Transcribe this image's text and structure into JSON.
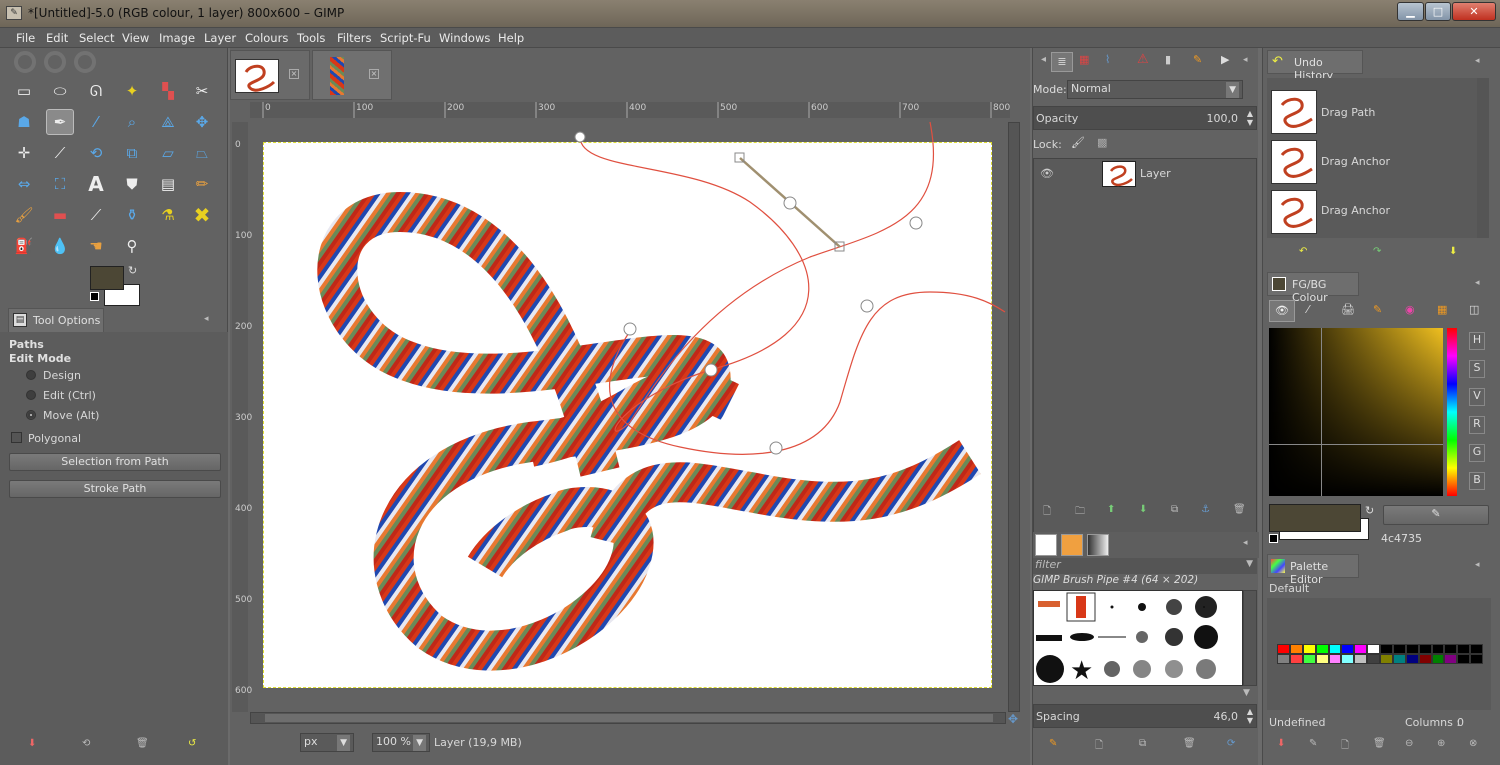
{
  "window": {
    "title": "*[Untitled]-5.0 (RGB colour, 1 layer) 800x600 – GIMP",
    "app_icon": "gimp-icon",
    "controls": [
      "minimize-icon",
      "maximize-icon",
      "close-icon"
    ]
  },
  "menu": [
    "File",
    "Edit",
    "Select",
    "View",
    "Image",
    "Layer",
    "Colours",
    "Tools",
    "Filters",
    "Script-Fu",
    "Windows",
    "Help"
  ],
  "tool_options": {
    "tab_label": "Tool Options",
    "tool_name": "Paths",
    "section": "Edit Mode",
    "modes": [
      "Design",
      "Edit (Ctrl)",
      "Move (Alt)"
    ],
    "selected_mode": "Move (Alt)",
    "polygonal_label": "Polygonal",
    "polygonal_checked": false,
    "btn_selection": "Selection from Path",
    "btn_stroke": "Stroke Path"
  },
  "colors": {
    "fg": "#4c4735",
    "bg": "#ffffff",
    "accent_path": "#e05040",
    "rope_colors": [
      "#d83818",
      "#2048b0",
      "#e87830",
      "#6a8a58",
      "#e8e8f0",
      "#c02818"
    ]
  },
  "rulers": {
    "h_ticks": [
      "0",
      "100",
      "200",
      "300",
      "400",
      "500",
      "600",
      "700",
      "800"
    ],
    "v_ticks": [
      "0",
      "100",
      "200",
      "300",
      "400",
      "500",
      "600"
    ]
  },
  "statusbar": {
    "unit": "px",
    "zoom": "100 %",
    "info": "Layer (19,9 MB)"
  },
  "layers": {
    "mode_label": "Mode:",
    "mode_value": "Normal",
    "opacity_label": "Opacity",
    "opacity_value": "100,0",
    "lock_label": "Lock:",
    "items": [
      {
        "name": "Layer",
        "visible": true
      }
    ]
  },
  "brushes": {
    "filter_placeholder": "filter",
    "current": "GIMP Brush Pipe #4 (64 × 202)",
    "spacing_label": "Spacing",
    "spacing_value": "46,0"
  },
  "undo": {
    "title": "Undo History",
    "items": [
      "Drag Path",
      "Drag Anchor",
      "Drag Anchor"
    ]
  },
  "fgbg": {
    "title": "FG/BG Colour",
    "hex": "4c4735",
    "channels": [
      "H",
      "S",
      "V",
      "R",
      "G",
      "B"
    ]
  },
  "palette": {
    "title": "Palette Editor",
    "name": "Default",
    "footer_name": "Undefined",
    "columns_label": "Columns :",
    "columns_value": "0",
    "swatches": [
      "#ff0000",
      "#ff8000",
      "#ffff00",
      "#00ff00",
      "#00ffff",
      "#0000ff",
      "#ff00ff",
      "#ffffff",
      "#000000",
      "#000000",
      "#000000",
      "#000000",
      "#000000",
      "#000000",
      "#000000",
      "#000000",
      "#808080",
      "#ff4040",
      "#40ff40",
      "#ffff80",
      "#ff80ff",
      "#80ffff",
      "#c0c0c0",
      "#404040",
      "#808000",
      "#008080",
      "#000080",
      "#800000",
      "#008000",
      "#800080",
      "#000000",
      "#000000"
    ]
  }
}
